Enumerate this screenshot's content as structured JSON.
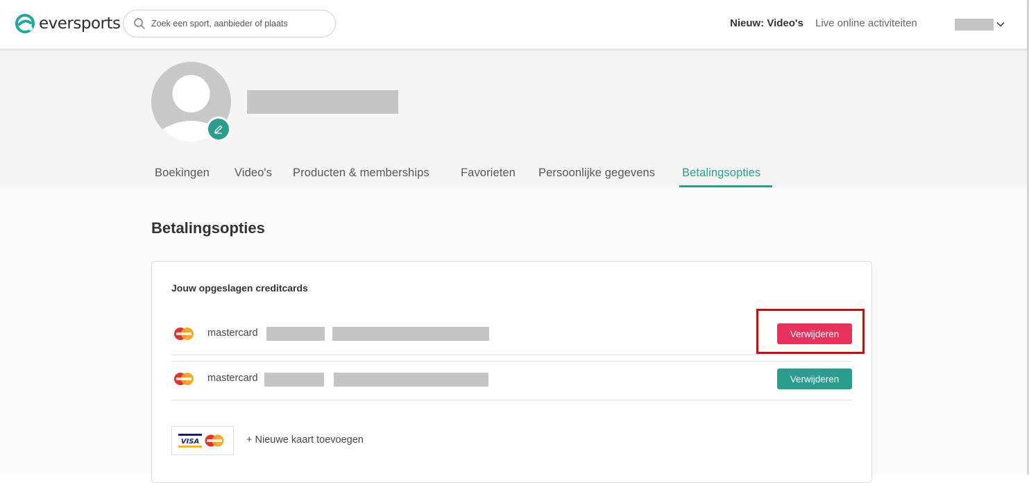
{
  "header": {
    "logo_text": "eversports",
    "search_placeholder": "Zoek een sport, aanbieder of plaats",
    "nav_new_video": "Nieuw: Video's",
    "nav_live": "Live online activiteiten"
  },
  "tabs": [
    {
      "label": "Boekingen"
    },
    {
      "label": "Video's"
    },
    {
      "label": "Producten & memberships"
    },
    {
      "label": "Favorieten"
    },
    {
      "label": "Persoonlijke gegevens"
    },
    {
      "label": "Betalingsopties",
      "active": true
    }
  ],
  "main": {
    "title": "Betalingsopties",
    "card_heading": "Jouw opgeslagen creditcards",
    "cards": [
      {
        "brand": "mastercard",
        "delete_label": "Verwijderen",
        "button_color": "#e8325c"
      },
      {
        "brand": "mastercard",
        "delete_label": "Verwijderen",
        "button_color": "#2a9d8f"
      }
    ],
    "add_card_label": "+ Nieuwe kaart toevoegen",
    "visa_text": "VISA"
  },
  "colors": {
    "accent": "#2a9d8f",
    "danger": "#e8325c",
    "highlight": "#e00000"
  },
  "icons": {
    "search": "search-icon",
    "chevron": "chevron-down-icon",
    "edit": "pencil-icon",
    "card": "mastercard-icon"
  }
}
